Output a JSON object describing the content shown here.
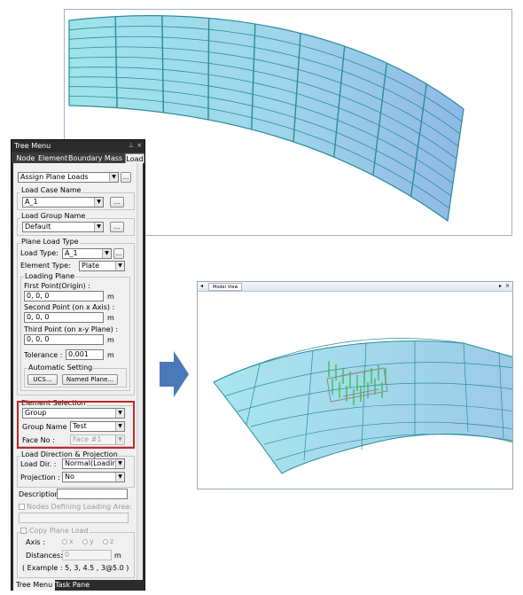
{
  "tree_menu": {
    "title": "Tree Menu",
    "pin_glyph": "⊥",
    "close_glyph": "×",
    "tabs": [
      "Node",
      "Element",
      "Boundary",
      "Mass",
      "Load"
    ],
    "active_tab": "Load",
    "bottom_tabs": [
      "Tree Menu",
      "Task Pane"
    ],
    "function_select": "Assign Plane Loads",
    "load_case": {
      "title": "Load Case Name",
      "value": "A_1",
      "more": "..."
    },
    "load_group": {
      "title": "Load Group Name",
      "value": "Default",
      "more": "..."
    },
    "plane_load_type": {
      "title": "Plane Load Type",
      "load_type_label": "Load Type:",
      "load_type_value": "A_1",
      "element_type_label": "Element Type:",
      "element_type_value": "Plate"
    },
    "loading_plane": {
      "title": "Loading Plane",
      "first_point_label": "First Point(Origin) :",
      "first_point_value": "0, 0, 0",
      "second_point_label": "Second Point (on x Axis) :",
      "second_point_value": "0, 0, 0",
      "third_point_label": "Third Point (on x-y Plane) :",
      "third_point_value": "0, 0, 0",
      "unit": "m",
      "tolerance_label": "Tolerance :",
      "tolerance_value": "0.001",
      "auto_setting_title": "Automatic Setting",
      "ucs_button": "UCS...",
      "named_plane_button": "Named Plane..."
    },
    "element_selection": {
      "title": "Element Selection",
      "mode_value": "Group",
      "group_name_label": "Group Name :",
      "group_name_value": "Test",
      "face_no_label": "Face No :",
      "face_no_value": "Face #1"
    },
    "load_direction": {
      "title": "Load Direction & Projection",
      "load_dir_label": "Load Dir. :",
      "load_dir_value": "Normal(Loading",
      "projection_label": "Projection :",
      "projection_value": "No"
    },
    "description_label": "Description:",
    "nodes_defining_label": "Nodes Defining Loading Area:",
    "copy_plane_load": {
      "title": "Copy Plane Load",
      "axis_label": "Axis :",
      "axis_options": [
        "x",
        "y",
        "z"
      ],
      "distances_label": "Distances:",
      "distances_value": "0",
      "unit": "m",
      "example": "( Example :   5, 3, 4.5 , 3@5.0 )"
    }
  },
  "model_view": {
    "tab_label": "Model View",
    "controls": [
      "◂",
      "▸",
      "×"
    ]
  },
  "colors": {
    "mesh_fill": "#a8e4ec",
    "mesh_line": "#2a8c9a",
    "highlight": "#c0282a",
    "arrow": "#4a78b8",
    "load_green": "#37c24a"
  },
  "icons": {
    "arrow": "right-arrow-icon",
    "combo": "chevron-down-icon"
  }
}
